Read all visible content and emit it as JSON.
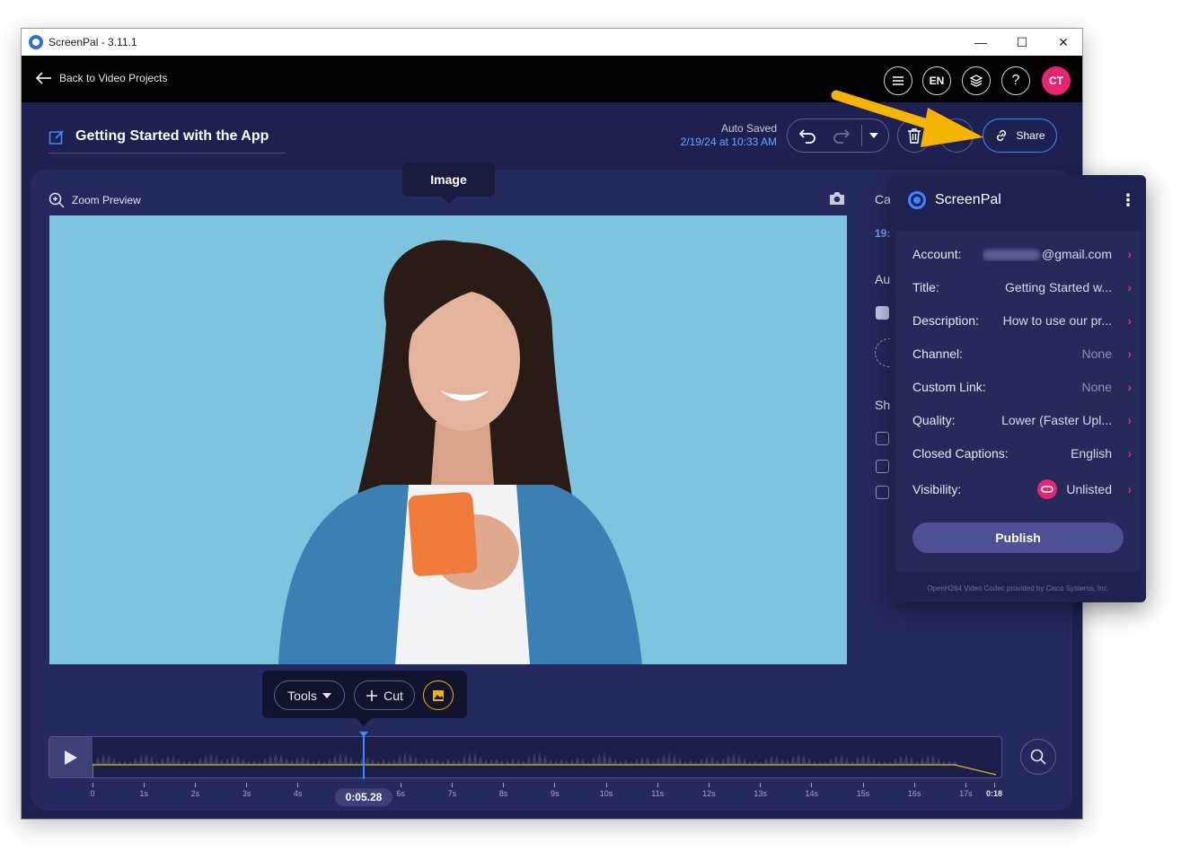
{
  "window": {
    "title": "ScreenPal - 3.11.1"
  },
  "topbar": {
    "back_label": "Back to Video Projects",
    "lang": "EN",
    "help": "?",
    "avatar_initials": "CT"
  },
  "header": {
    "project_title": "Getting Started with the App",
    "autosave_label": "Auto Saved",
    "autosave_time": "2/19/24 at 10:33 AM",
    "share_label": "Share"
  },
  "preview": {
    "zoom_label": "Zoom Preview",
    "tooltip": "Image"
  },
  "side": {
    "l1": "Ca",
    "l2": "19:",
    "l3": "Au",
    "l4": "Sh"
  },
  "tools": {
    "tools_label": "Tools",
    "cut_label": "Cut"
  },
  "timeline": {
    "current_time": "0:05.28",
    "end_time": "0:18",
    "tick_labels": [
      "0",
      "1s",
      "2s",
      "3s",
      "4s",
      "5s",
      "6s",
      "7s",
      "8s",
      "9s",
      "10s",
      "11s",
      "12s",
      "13s",
      "14s",
      "15s",
      "16s",
      "17s"
    ]
  },
  "share_panel": {
    "brand": "ScreenPal",
    "rows": [
      {
        "key": "Account:",
        "value": "@gmail.com"
      },
      {
        "key": "Title:",
        "value": "Getting Started w..."
      },
      {
        "key": "Description:",
        "value": "How to use our pr..."
      },
      {
        "key": "Channel:",
        "value": "None"
      },
      {
        "key": "Custom Link:",
        "value": "None"
      },
      {
        "key": "Quality:",
        "value": "Lower (Faster Upl..."
      },
      {
        "key": "Closed Captions:",
        "value": "English"
      },
      {
        "key": "Visibility:",
        "value": "Unlisted"
      }
    ],
    "publish_label": "Publish",
    "footer": "OpenH264 Video Codec provided by Cisco Systems, Inc."
  },
  "colors": {
    "accent_blue": "#3b8cff",
    "brand_pink": "#e3266f",
    "annotation_arrow": "#f5b400"
  }
}
